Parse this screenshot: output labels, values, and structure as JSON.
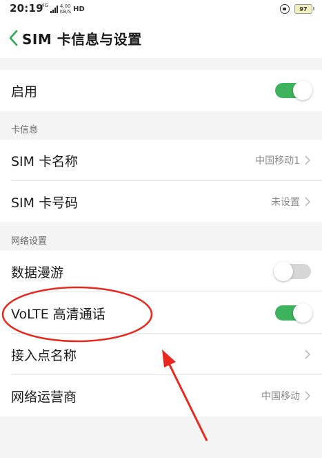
{
  "status_bar": {
    "time": "20:19",
    "network_type": "4G",
    "speed_value": "4.00",
    "speed_unit": "KB/S",
    "hd_label": "HD",
    "battery": "97"
  },
  "header": {
    "title": "SIM 卡信息与设置"
  },
  "rows": {
    "enable": {
      "label": "启用",
      "toggle_on": true
    },
    "card_info_section": "卡信息",
    "sim_name": {
      "label": "SIM 卡名称",
      "value": "中国移动1"
    },
    "sim_number": {
      "label": "SIM 卡号码",
      "value": "未设置"
    },
    "network_section": "网络设置",
    "data_roaming": {
      "label": "数据漫游",
      "toggle_on": false
    },
    "volte": {
      "label": "VoLTE 高清通话",
      "toggle_on": true
    },
    "apn": {
      "label": "接入点名称"
    },
    "carrier": {
      "label": "网络运营商",
      "value": "中国移动"
    }
  },
  "colors": {
    "toggle_on": "#3fb25e",
    "toggle_off": "#d6d6d6",
    "annotation": "#e8281e",
    "back_chevron": "#2fa84f"
  },
  "icons": {
    "back": "chevron-left-icon",
    "row_chevron": "chevron-right-icon"
  }
}
